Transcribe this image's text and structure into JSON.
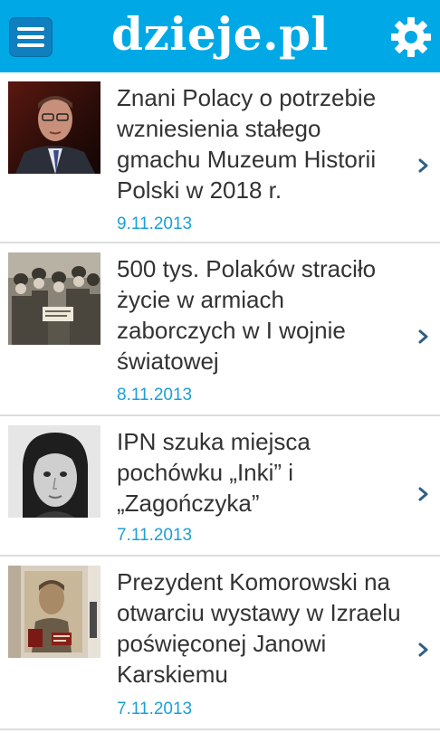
{
  "app": {
    "title": "dzieje.pl"
  },
  "header": {
    "menu_icon": "menu-icon",
    "settings_icon": "gear-icon",
    "background_color": "#00a9e6",
    "menu_button_color": "#0f7fbf"
  },
  "articles": [
    {
      "title": "Znani Polacy o potrzebie wzniesienia stałego gmachu Muzeum Historii Polski w 2018 r.",
      "date": "9.11.2013",
      "thumbnail": "man in suit with glasses"
    },
    {
      "title": "500 tys. Polaków straciło życie w armiach zaborczych w I wojnie światowej",
      "date": "8.11.2013",
      "thumbnail": "soldiers group sepia photo"
    },
    {
      "title": "IPN szuka miejsca pochówku „Inki” i „Zagończyka”",
      "date": "7.11.2013",
      "thumbnail": "black and white portrait of young woman"
    },
    {
      "title": "Prezydent Komorowski na otwarciu wystawy w Izraelu poświęconej Janowi Karskiemu",
      "date": "7.11.2013",
      "thumbnail": "exhibition wall with portrait"
    }
  ],
  "colors": {
    "date": "#1ba0d6",
    "title": "#333333",
    "divider": "#dcdcdc"
  }
}
